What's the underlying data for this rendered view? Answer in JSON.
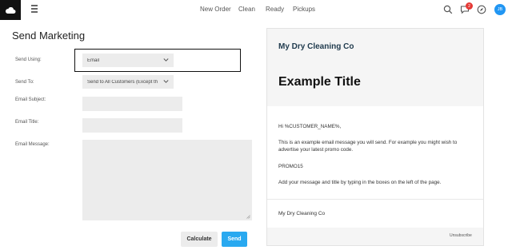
{
  "nav": {
    "items": [
      "New Order",
      "Clean",
      "Ready",
      "Pickups"
    ]
  },
  "header": {
    "notification_count": "2",
    "avatar_initials": "JB"
  },
  "form": {
    "title": "Send Marketing",
    "send_using_label": "Send Using:",
    "send_using_value": "Email",
    "send_to_label": "Send To:",
    "send_to_value": "Send to All Customers (Except th",
    "subject_label": "Email Subject:",
    "email_title_label": "Email Title:",
    "message_label": "Email Message:",
    "calculate_label": "Calculate",
    "send_label": "Send"
  },
  "preview": {
    "brand": "My Dry Cleaning Co",
    "title": "Example Title",
    "greeting": "Hi %CUSTOMER_NAME%,",
    "paragraph": "This is an example email message you will send. For example you might wish to advertise your latest promo code.",
    "promo": "PROMO15",
    "instructions": "Add your message and title by typing in the boxes on the left of the page.",
    "footer": "My Dry Cleaning Co",
    "unsubscribe": "Unsubscribe"
  },
  "colors": {
    "accent": "#29a9f0",
    "badge": "#e53935",
    "avatar": "#2196f3",
    "brand_text": "#1f3a4d"
  }
}
